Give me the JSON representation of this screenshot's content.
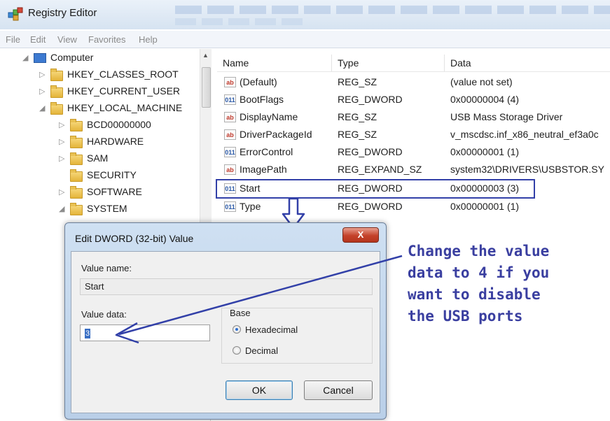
{
  "window": {
    "title": "Registry Editor"
  },
  "menu": [
    "File",
    "Edit",
    "View",
    "Favorites",
    "Help"
  ],
  "tree": {
    "root": "Computer",
    "items": [
      {
        "label": "HKEY_CLASSES_ROOT",
        "expander": "▷"
      },
      {
        "label": "HKEY_CURRENT_USER",
        "expander": "▷"
      },
      {
        "label": "HKEY_LOCAL_MACHINE",
        "expander": "◢"
      },
      {
        "label": "BCD00000000",
        "expander": "▷"
      },
      {
        "label": "HARDWARE",
        "expander": "▷"
      },
      {
        "label": "SAM",
        "expander": "▷"
      },
      {
        "label": "SECURITY",
        "expander": ""
      },
      {
        "label": "SOFTWARE",
        "expander": "▷"
      },
      {
        "label": "SYSTEM",
        "expander": "◢"
      }
    ]
  },
  "list": {
    "columns": [
      "Name",
      "Type",
      "Data"
    ],
    "rows": [
      {
        "icon": "ab",
        "name": "(Default)",
        "type": "REG_SZ",
        "data": "(value not set)"
      },
      {
        "icon": "011",
        "name": "BootFlags",
        "type": "REG_DWORD",
        "data": "0x00000004 (4)"
      },
      {
        "icon": "ab",
        "name": "DisplayName",
        "type": "REG_SZ",
        "data": "USB Mass Storage Driver"
      },
      {
        "icon": "ab",
        "name": "DriverPackageId",
        "type": "REG_SZ",
        "data": "v_mscdsc.inf_x86_neutral_ef3a0c"
      },
      {
        "icon": "011",
        "name": "ErrorControl",
        "type": "REG_DWORD",
        "data": "0x00000001 (1)"
      },
      {
        "icon": "ab",
        "name": "ImagePath",
        "type": "REG_EXPAND_SZ",
        "data": "system32\\DRIVERS\\USBSTOR.SY"
      },
      {
        "icon": "011",
        "name": "Start",
        "type": "REG_DWORD",
        "data": "0x00000003 (3)"
      },
      {
        "icon": "011",
        "name": "Type",
        "type": "REG_DWORD",
        "data": "0x00000001 (1)"
      }
    ]
  },
  "dialog": {
    "title": "Edit DWORD (32-bit) Value",
    "close_label": "X",
    "value_name_label": "Value name:",
    "value_name": "Start",
    "value_data_label": "Value data:",
    "value_data": "3",
    "base_label": "Base",
    "hex_label": "Hexadecimal",
    "dec_label": "Decimal",
    "ok_label": "OK",
    "cancel_label": "Cancel"
  },
  "annotation": {
    "lines": [
      "Change the value",
      "data to 4 if you",
      "want to disable",
      "the USB ports"
    ]
  },
  "colors": {
    "annotation": "#3a3fa0",
    "highlight": "#3240a8"
  }
}
